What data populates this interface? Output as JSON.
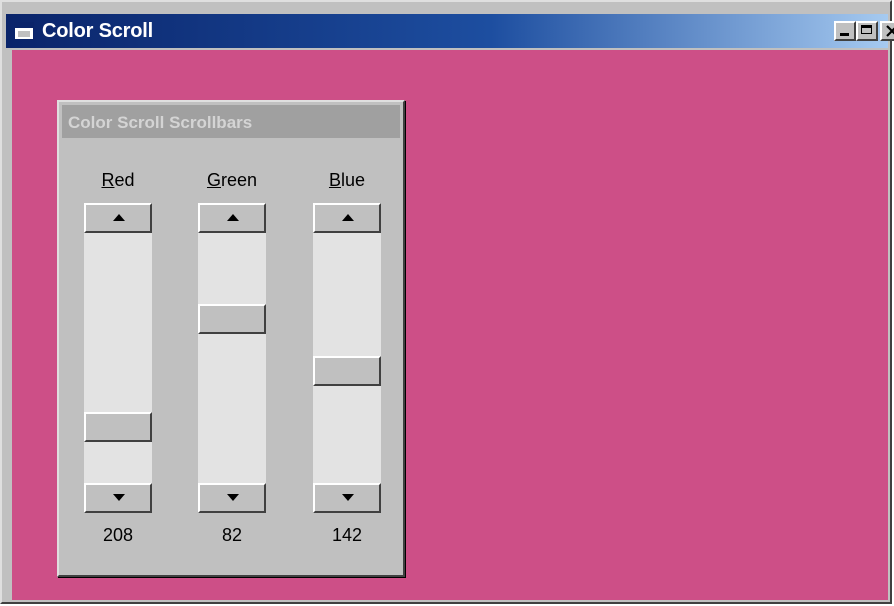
{
  "window": {
    "title": "Color Scroll",
    "background_color": "#cd4f87",
    "icons": {
      "minimize": "minimize-icon",
      "maximize": "maximize-icon",
      "close": "close-icon"
    }
  },
  "dialog": {
    "title": "Color Scroll Scrollbars",
    "channels": [
      {
        "label": "Red",
        "value": "208",
        "level": 208,
        "max": 255
      },
      {
        "label": "Green",
        "value": "82",
        "level": 82,
        "max": 255
      },
      {
        "label": "Blue",
        "value": "142",
        "level": 142,
        "max": 255
      }
    ]
  }
}
